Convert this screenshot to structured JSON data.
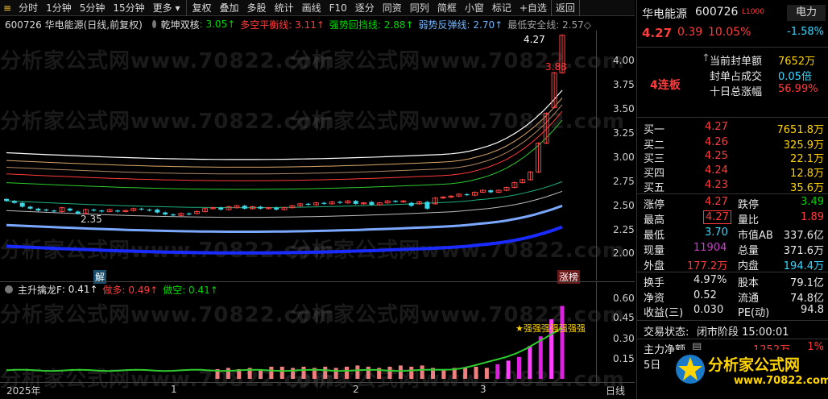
{
  "toolbar": {
    "items": [
      "分时",
      "1分钟",
      "5分钟",
      "15分钟",
      "更多",
      "复权",
      "叠加",
      "多股",
      "统计",
      "画线",
      "F10",
      "逐分",
      "同资",
      "同列",
      "简框",
      "小窗",
      "标记",
      "+自选",
      "返回"
    ]
  },
  "main_header": {
    "code_name": "600726  华电能源(日线,前复权)",
    "indicator": "乾坤双核",
    "v1": ": 3.05↑",
    "v2": "多空平衡线: 3.11↑",
    "v3": "强势回挡线: 2.88↑",
    "v4": "弱势反弹线: 2.70↑",
    "v5": "最低安全线: 2.57◇"
  },
  "sub_header": {
    "name": "主升擒龙F",
    "v1": ": 0.41↑",
    "v2": "做多: 0.49↑",
    "v3": "做空: 0.41↑"
  },
  "main_axis": [
    "4.00",
    "3.75",
    "3.50",
    "3.25",
    "3.00",
    "2.75",
    "2.50",
    "2.25",
    "2.00"
  ],
  "sub_axis": [
    "0.60",
    "0.45",
    "0.30",
    "0.15"
  ],
  "x_axis": [
    "2025年",
    "1",
    "2",
    "3",
    "日线"
  ],
  "annotations": {
    "high": "4.27",
    "mid": "3.88",
    "low": "2.35",
    "jie": "解",
    "zhangbang": "涨榜",
    "strong": "★强强强强强强强"
  },
  "watermark": "分析家公式网www.70822.com",
  "panel": {
    "name": "华电能源",
    "code": "600726",
    "tag": "L1000",
    "sector": "电力",
    "sector_pct": "-1.58%",
    "price": "4.27",
    "change": "0.39",
    "pct": "10.05%",
    "limit_label": "4连板",
    "seal_amount_label": "当前封单额",
    "seal_amount": "7652万",
    "seal_ratio_label": "封单占成交",
    "seal_ratio": "0.05倍",
    "ten_day_label": "十日总涨幅",
    "ten_day": "56.99%",
    "bids": [
      {
        "label": "买一",
        "price": "4.27",
        "vol": "7651.8万"
      },
      {
        "label": "买二",
        "price": "4.26",
        "vol": "325.9万"
      },
      {
        "label": "买三",
        "price": "4.25",
        "vol": "22.1万"
      },
      {
        "label": "买四",
        "price": "4.24",
        "vol": "12.8万"
      },
      {
        "label": "买五",
        "price": "4.23",
        "vol": "35.6万"
      }
    ],
    "stats": [
      {
        "l1": "涨停",
        "v1": "4.27",
        "l2": "跌停",
        "v2": "3.49"
      },
      {
        "l1": "最高",
        "v1": "4.27",
        "l2": "量比",
        "v2": "1.89"
      },
      {
        "l1": "最低",
        "v1": "3.70",
        "l2": "市值AB",
        "v2": "337.6亿"
      },
      {
        "l1": "现量",
        "v1": "11904",
        "l2": "总量",
        "v2": "371.6万"
      },
      {
        "l1": "外盘",
        "v1": "177.2万",
        "l2": "内盘",
        "v2": "194.4万"
      }
    ],
    "stats2": [
      {
        "l1": "换手",
        "v1": "4.97%",
        "l2": "股本",
        "v2": "79.1亿"
      },
      {
        "l1": "净资",
        "v1": "0.52",
        "l2": "流通",
        "v2": "74.8亿"
      },
      {
        "l1": "收益(三)",
        "v1": "0.030",
        "l2": "PE(动)",
        "v2": "94.8"
      }
    ],
    "status_label": "交易状态:",
    "status": "闭市阶段 15:00:01",
    "net_label": "主力净额",
    "net_value": "1252万",
    "net_pct": "1%",
    "day_label": "5日",
    "logo_text": "分析家公式网",
    "logo_url": "www.70822.com"
  },
  "chart_data": {
    "type": "bar",
    "x": [
      "2025年",
      "1",
      "2",
      "3"
    ],
    "ylim_main": [
      1.9,
      4.35
    ],
    "ylim_sub": [
      0.0,
      0.65
    ],
    "candles": [
      {
        "o": 2.57,
        "c": 2.55
      },
      {
        "o": 2.55,
        "c": 2.53
      },
      {
        "o": 2.53,
        "c": 2.49
      },
      {
        "o": 2.49,
        "c": 2.47
      },
      {
        "o": 2.47,
        "c": 2.45
      },
      {
        "o": 2.46,
        "c": 2.45
      },
      {
        "o": 2.45,
        "c": 2.44
      },
      {
        "o": 2.44,
        "c": 2.48
      },
      {
        "o": 2.47,
        "c": 2.45
      },
      {
        "o": 2.44,
        "c": 2.42
      },
      {
        "o": 2.42,
        "c": 2.46
      },
      {
        "o": 2.46,
        "c": 2.45
      },
      {
        "o": 2.45,
        "c": 2.44
      },
      {
        "o": 2.44,
        "c": 2.46
      },
      {
        "o": 2.45,
        "c": 2.44
      },
      {
        "o": 2.44,
        "c": 2.45
      },
      {
        "o": 2.45,
        "c": 2.47
      },
      {
        "o": 2.47,
        "c": 2.46
      },
      {
        "o": 2.46,
        "c": 2.45
      },
      {
        "o": 2.46,
        "c": 2.43
      },
      {
        "o": 2.43,
        "c": 2.41
      },
      {
        "o": 2.41,
        "c": 2.4
      },
      {
        "o": 2.4,
        "c": 2.42
      },
      {
        "o": 2.42,
        "c": 2.41
      },
      {
        "o": 2.42,
        "c": 2.44
      },
      {
        "o": 2.44,
        "c": 2.47
      },
      {
        "o": 2.47,
        "c": 2.48
      },
      {
        "o": 2.48,
        "c": 2.46
      },
      {
        "o": 2.46,
        "c": 2.49
      },
      {
        "o": 2.48,
        "c": 2.5
      },
      {
        "o": 2.5,
        "c": 2.47
      },
      {
        "o": 2.47,
        "c": 2.49
      },
      {
        "o": 2.49,
        "c": 2.47
      },
      {
        "o": 2.47,
        "c": 2.48
      },
      {
        "o": 2.48,
        "c": 2.46
      },
      {
        "o": 2.46,
        "c": 2.48
      },
      {
        "o": 2.48,
        "c": 2.5
      },
      {
        "o": 2.5,
        "c": 2.52
      },
      {
        "o": 2.52,
        "c": 2.51
      },
      {
        "o": 2.51,
        "c": 2.53
      },
      {
        "o": 2.53,
        "c": 2.52
      },
      {
        "o": 2.52,
        "c": 2.54
      },
      {
        "o": 2.54,
        "c": 2.53
      },
      {
        "o": 2.53,
        "c": 2.55
      },
      {
        "o": 2.55,
        "c": 2.52
      },
      {
        "o": 2.52,
        "c": 2.53
      },
      {
        "o": 2.54,
        "c": 2.51
      },
      {
        "o": 2.51,
        "c": 2.53
      },
      {
        "o": 2.53,
        "c": 2.55
      },
      {
        "o": 2.55,
        "c": 2.54
      },
      {
        "o": 2.54,
        "c": 2.55
      },
      {
        "o": 2.53,
        "c": 2.5
      },
      {
        "o": 2.52,
        "c": 2.54
      },
      {
        "o": 2.54,
        "c": 2.47
      },
      {
        "o": 2.52,
        "c": 2.58
      },
      {
        "o": 2.58,
        "c": 2.59
      },
      {
        "o": 2.59,
        "c": 2.6
      },
      {
        "o": 2.6,
        "c": 2.62
      },
      {
        "o": 2.62,
        "c": 2.61
      },
      {
        "o": 2.61,
        "c": 2.64
      },
      {
        "o": 2.64,
        "c": 2.66
      },
      {
        "o": 2.66,
        "c": 2.64
      },
      {
        "o": 2.64,
        "c": 2.66
      },
      {
        "o": 2.66,
        "c": 2.69
      },
      {
        "o": 2.69,
        "c": 2.74
      },
      {
        "o": 2.74,
        "c": 2.77
      },
      {
        "o": 2.77,
        "c": 2.85
      },
      {
        "o": 2.85,
        "c": 3.15
      },
      {
        "o": 3.15,
        "c": 3.46
      },
      {
        "o": 3.52,
        "c": 3.88
      },
      {
        "o": 3.88,
        "c": 4.27
      }
    ],
    "ma_white": 3.05,
    "sub_bars": [
      0.08,
      0.09,
      0.08,
      0.09,
      0.08,
      0.1,
      0.1,
      0.09,
      0.1,
      0.09,
      0.1,
      0.09,
      0.1,
      0.11,
      0.1,
      0.09,
      0.1,
      0.11,
      0.1,
      0.11,
      0.09,
      0.08,
      0.09,
      0.09,
      0.1,
      0.09,
      0.12,
      0.15,
      0.18,
      0.27,
      0.35,
      0.49,
      0.6
    ]
  }
}
